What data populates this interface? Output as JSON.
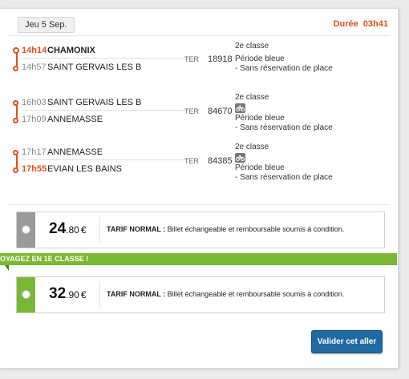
{
  "header": {
    "date": "Jeu 5 Sep.",
    "duration_label": "Durée",
    "duration_value": "03h41"
  },
  "legs": [
    {
      "departure": {
        "time": "14h14",
        "station": "CHAMONIX"
      },
      "arrival": {
        "time": "14h57",
        "station": "SAINT GERVAIS LES B"
      },
      "mode": "TER",
      "train_number": "18918",
      "class": "2e classe",
      "bike_icon": false,
      "period": "Période bleue",
      "reservation": "- Sans réservation de place"
    },
    {
      "departure": {
        "time": "16h03",
        "station": "SAINT GERVAIS LES B"
      },
      "arrival": {
        "time": "17h09",
        "station": "ANNEMASSE"
      },
      "mode": "TER",
      "train_number": "84670",
      "class": "2e classe",
      "bike_icon": true,
      "period": "Période bleue",
      "reservation": "- Sans réservation de place"
    },
    {
      "departure": {
        "time": "17h17",
        "station": "ANNEMASSE"
      },
      "arrival": {
        "time": "17h55",
        "station": "EVIAN LES BAINS"
      },
      "mode": "TER",
      "train_number": "84385",
      "class": "2e classe",
      "bike_icon": true,
      "period": "Période bleue",
      "reservation": "- Sans réservation de place"
    }
  ],
  "fares": [
    {
      "price_int": "24",
      "price_dec": ".80",
      "currency": "€",
      "tariff_label": "TARIF NORMAL :",
      "tariff_desc": " Billet échangeable et remboursable soumis à condition.",
      "rail_color": "#9a9a9a"
    },
    {
      "price_int": "32",
      "price_dec": ".90",
      "currency": "€",
      "tariff_label": "TARIF NORMAL :",
      "tariff_desc": " Billet échangeable et remboursable soumis à condition.",
      "rail_color": "#7ab833"
    }
  ],
  "first_class_banner": "OYAGEZ EN 1E CLASSE !",
  "validate_button": "Valider cet aller",
  "colors": {
    "accent_orange": "#e0501c",
    "green": "#7ab833",
    "button_blue": "#1f6aa3"
  }
}
